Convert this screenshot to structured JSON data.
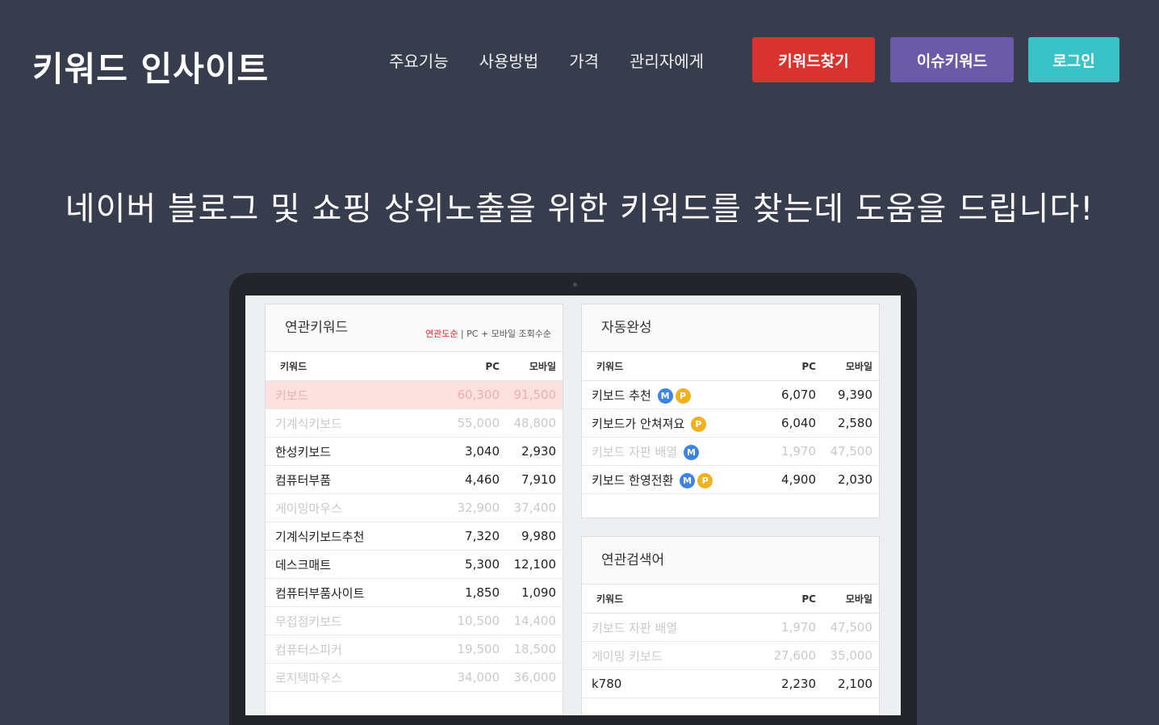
{
  "header": {
    "logo": "키워드 인사이트",
    "nav": [
      "주요기능",
      "사용방법",
      "가격",
      "관리자에게"
    ],
    "btn_find": "키워드찾기",
    "btn_issue": "이슈키워드",
    "btn_login": "로그인"
  },
  "hero": {
    "text": "네이버 블로그 및 쇼핑 상위노출을 위한 키워드를 찾는데 도움을 드립니다!"
  },
  "related": {
    "title": "연관키워드",
    "sort_red": "연관도순",
    "sort_rest": " | PC + 모바일 조회수순",
    "headers": {
      "kw": "키워드",
      "pc": "PC",
      "mobile": "모바일"
    },
    "rows": [
      {
        "kw": "키보드",
        "pc": "60,300",
        "mobile": "91,500"
      },
      {
        "kw": "기계식키보드",
        "pc": "55,000",
        "mobile": "48,800"
      },
      {
        "kw": "한성키보드",
        "pc": "3,040",
        "mobile": "2,930"
      },
      {
        "kw": "컴퓨터부품",
        "pc": "4,460",
        "mobile": "7,910"
      },
      {
        "kw": "게이밍마우스",
        "pc": "32,900",
        "mobile": "37,400"
      },
      {
        "kw": "기계식키보드추천",
        "pc": "7,320",
        "mobile": "9,980"
      },
      {
        "kw": "데스크매트",
        "pc": "5,300",
        "mobile": "12,100"
      },
      {
        "kw": "컴퓨터부품사이트",
        "pc": "1,850",
        "mobile": "1,090"
      },
      {
        "kw": "무접점키보드",
        "pc": "10,500",
        "mobile": "14,400"
      },
      {
        "kw": "컴퓨터스피커",
        "pc": "19,500",
        "mobile": "18,500"
      },
      {
        "kw": "로지텍마우스",
        "pc": "34,000",
        "mobile": "36,000"
      }
    ]
  },
  "autocomplete": {
    "title": "자동완성",
    "headers": {
      "kw": "키워드",
      "pc": "PC",
      "mobile": "모바일"
    },
    "badge_m": "M",
    "badge_p": "P",
    "rows": [
      {
        "kw": "키보드 추천",
        "pc": "6,070",
        "mobile": "9,390"
      },
      {
        "kw": "키보드가 안쳐져요",
        "pc": "6,040",
        "mobile": "2,580"
      },
      {
        "kw": "키보드 자판 배열",
        "pc": "1,970",
        "mobile": "47,500"
      },
      {
        "kw": "키보드 한영전환",
        "pc": "4,900",
        "mobile": "2,030"
      }
    ]
  },
  "search": {
    "title": "연관검색어",
    "headers": {
      "kw": "키워드",
      "pc": "PC",
      "mobile": "모바일"
    },
    "rows": [
      {
        "kw": "키보드 자판 배열",
        "pc": "1,970",
        "mobile": "47,500"
      },
      {
        "kw": "게이밍 키보드",
        "pc": "27,600",
        "mobile": "35,000"
      },
      {
        "kw": "k780",
        "pc": "2,230",
        "mobile": "2,100"
      }
    ]
  },
  "colors": {
    "background": "#383d4e",
    "find": "#d9332f",
    "issue": "#6a5aa8",
    "login": "#3ac3c6",
    "badge_m": "#3d84e0",
    "badge_p": "#f0b11f"
  }
}
